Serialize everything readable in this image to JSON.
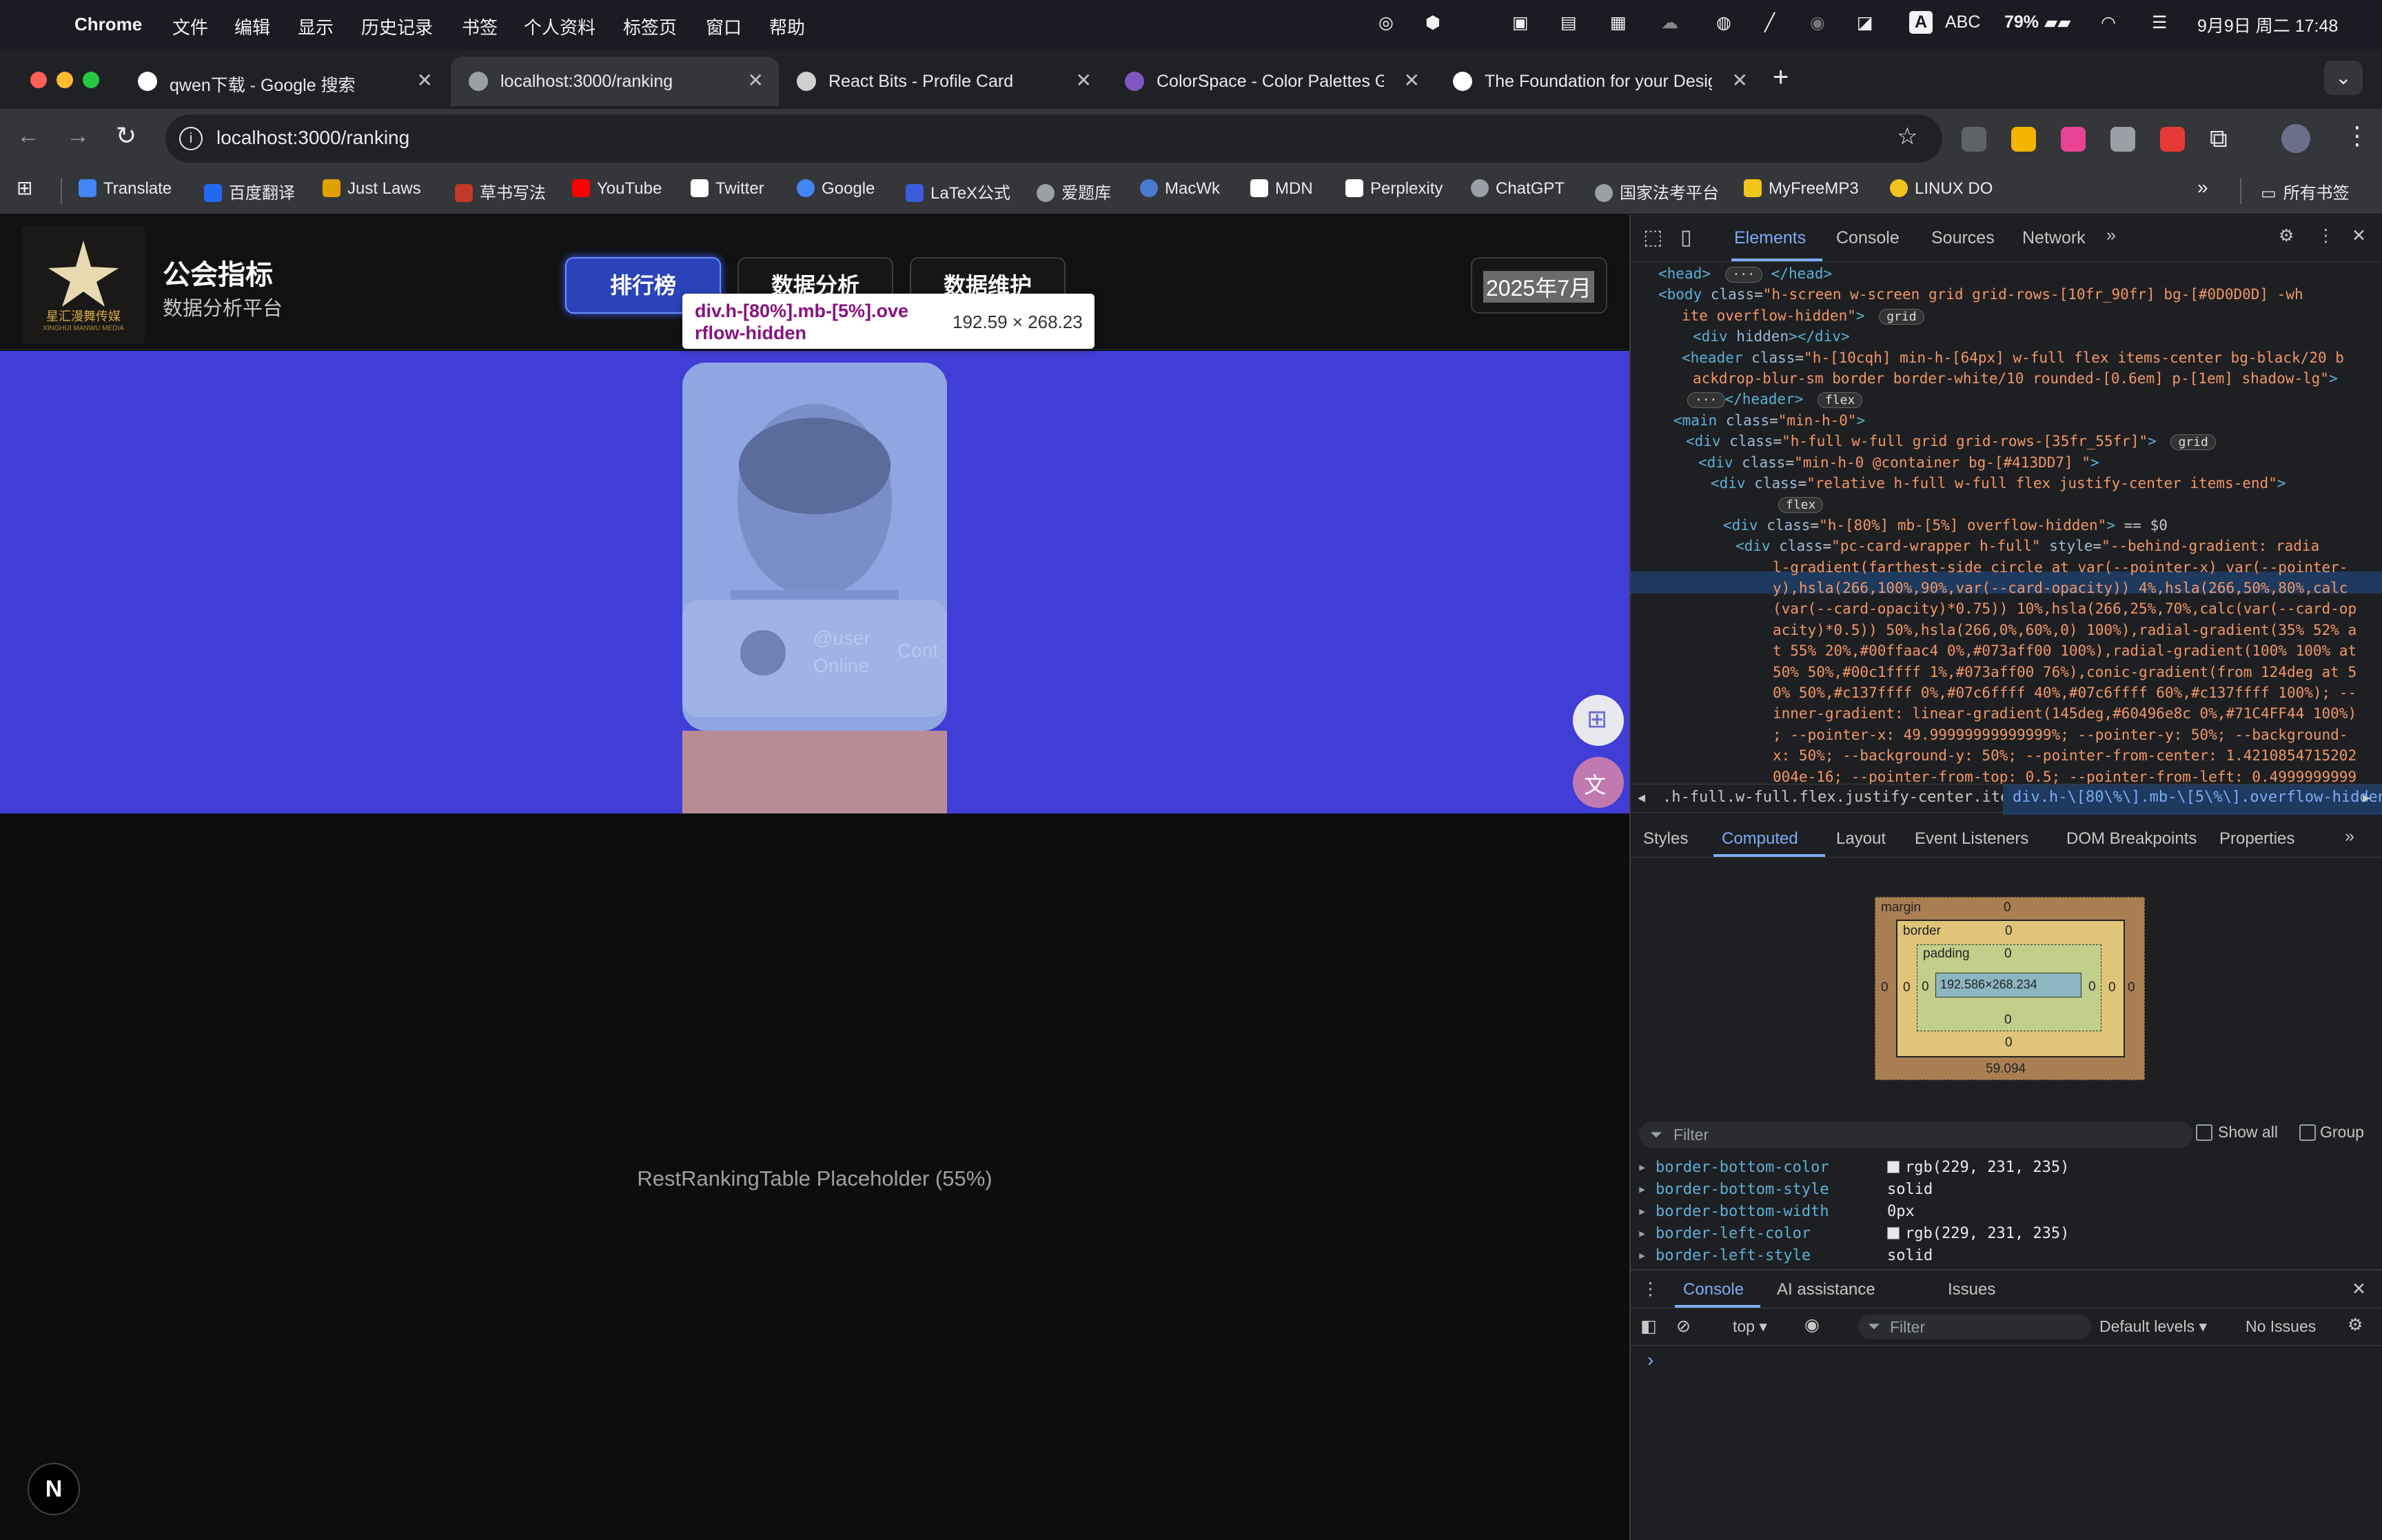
{
  "menubar": {
    "app": "Chrome",
    "items": [
      "文件",
      "编辑",
      "显示",
      "历史记录",
      "书签",
      "个人资料",
      "标签页",
      "窗口",
      "帮助"
    ],
    "input_method": "A",
    "abc": "ABC",
    "battery": "79%",
    "datetime": "9月9日 周二 17:48"
  },
  "tabs": [
    {
      "title": "qwen下载 - Google 搜索",
      "active": false
    },
    {
      "title": "localhost:3000/ranking",
      "active": true
    },
    {
      "title": "React Bits - Profile Card",
      "active": false
    },
    {
      "title": "ColorSpace - Color Palettes G",
      "active": false
    },
    {
      "title": "The Foundation for your Desig",
      "active": false
    }
  ],
  "address": {
    "url": "localhost:3000/ranking"
  },
  "bookmarks": [
    {
      "label": "Translate",
      "color": "#4285f4"
    },
    {
      "label": "百度翻译",
      "color": "#2468f2"
    },
    {
      "label": "Just Laws",
      "color": "#e0a000"
    },
    {
      "label": "草书写法",
      "color": "#c0392b"
    },
    {
      "label": "YouTube",
      "color": "#ff0000"
    },
    {
      "label": "Twitter",
      "color": "#ffffff"
    },
    {
      "label": "Google",
      "color": "#4285f4"
    },
    {
      "label": "LaTeX公式",
      "color": "#3b5bdb"
    },
    {
      "label": "爱题库",
      "color": "#9aa0a6"
    },
    {
      "label": "MacWk",
      "color": "#4a7bd0"
    },
    {
      "label": "MDN",
      "color": "#ffffff"
    },
    {
      "label": "Perplexity",
      "color": "#ffffff"
    },
    {
      "label": "ChatGPT",
      "color": "#9aa0a6"
    },
    {
      "label": "国家法考平台",
      "color": "#9aa0a6"
    },
    {
      "label": "MyFreeMP3",
      "color": "#f0c419"
    },
    {
      "label": "LINUX DO",
      "color": "#f0c419"
    }
  ],
  "all_bookmarks": "所有书签",
  "app": {
    "logo_text": "星汇漫舞传媒",
    "logo_subtext": "XINGHUI MANWU MEDIA",
    "title": "公会指标",
    "subtitle": "数据分析平台",
    "nav": [
      "排行榜",
      "数据分析",
      "数据维护"
    ],
    "active_nav": "排行榜",
    "date_select": "2025年7月",
    "placeholder_text": "RestRankingTable Placeholder (55%)",
    "profile_card": {
      "handle": "@user",
      "status": "Online",
      "contact": "Cont"
    },
    "next_badge": "N"
  },
  "inspect_tooltip": {
    "selector_line1": "div.h-[80%].mb-[5%].ove",
    "selector_line2": "rflow-hidden",
    "size": "192.59 × 268.23"
  },
  "devtools": {
    "tabs": [
      "Elements",
      "Console",
      "Sources",
      "Network"
    ],
    "active_tab": "Elements",
    "dom": [
      {
        "html": "<span class='tag'>&lt;head&gt;</span> <span class='badge'>···</span> <span class='tag'>&lt;/head&gt;</span>"
      },
      {
        "html": "<span class='tag'>&lt;body</span> <span class='attr'>class</span>=<span class='val'>\"h-screen w-screen grid grid-rows-[10fr_90fr] bg-[#0D0D0D] -wh</span>"
      },
      {
        "html": "<span class='val'>ite overflow-hidden\"</span><span class='tag'>&gt;</span> <span class='badge'>grid</span>"
      },
      {
        "html": "<span class='tag'>&lt;div</span> <span class='attr'>hidden</span><span class='tag'>&gt;&lt;/div&gt;</span>"
      },
      {
        "html": "<span class='tag'>&lt;header</span> <span class='attr'>class</span>=<span class='val'>\"h-[10cqh] min-h-[64px] w-full flex items-center bg-black/20 b</span>"
      },
      {
        "html": "<span class='val'>ackdrop-blur-sm border border-white/10 rounded-[0.6em] p-[1em] shadow-lg\"</span><span class='tag'>&gt;</span>"
      },
      {
        "html": "<span class='badge'>···</span><span class='tag'>&lt;/header&gt;</span> <span class='badge'>flex</span>"
      },
      {
        "html": "<span class='tag'>&lt;main</span> <span class='attr'>class</span>=<span class='val'>\"min-h-0\"</span><span class='tag'>&gt;</span>"
      },
      {
        "html": "<span class='tag'>&lt;div</span> <span class='attr'>class</span>=<span class='val'>\"h-full w-full grid grid-rows-[35fr_55fr]\"</span><span class='tag'>&gt;</span> <span class='badge'>grid</span>"
      },
      {
        "html": "<span class='tag'>&lt;div</span> <span class='attr'>class</span>=<span class='val'>\"min-h-0 @container bg-[#413DD7] \"</span><span class='tag'>&gt;</span>"
      },
      {
        "html": "<span class='tag'>&lt;div</span> <span class='attr'>class</span>=<span class='val'>\"relative h-full w-full flex justify-center items-end\"</span><span class='tag'>&gt;</span>"
      },
      {
        "html": "<span class='badge'>flex</span>"
      },
      {
        "html": "<span class='tag'>&lt;div</span> <span class='attr'>class</span>=<span class='val'>\"h-[80%] mb-[5%] overflow-hidden\"</span><span class='tag'>&gt;</span> == $0"
      },
      {
        "html": "<span class='tag'>&lt;div</span> <span class='attr'>class</span>=<span class='val'>\"pc-card-wrapper h-full\"</span> <span class='attr'>style</span>=<span class='val'>\"--behind-gradient: radia</span>"
      },
      {
        "html": "<span class='val'>l-gradient(farthest-side circle at var(--pointer-x) var(--pointer-</span>"
      },
      {
        "html": "<span class='val'>y),hsla(266,100%,90%,var(--card-opacity)) 4%,hsla(266,50%,80%,calc</span>"
      },
      {
        "html": "<span class='val'>(var(--card-opacity)*0.75)) 10%,hsla(266,25%,70%,calc(var(--card-op</span>"
      },
      {
        "html": "<span class='val'>acity)*0.5)) 50%,hsla(266,0%,60%,0) 100%),radial-gradient(35% 52% a</span>"
      },
      {
        "html": "<span class='val'>t 55% 20%,#00ffaac4 0%,#073aff00 100%),radial-gradient(100% 100% at</span>"
      },
      {
        "html": "<span class='val'>50% 50%,#00c1ffff 1%,#073aff00 76%),conic-gradient(from 124deg at 5</span>"
      },
      {
        "html": "<span class='val'>0% 50%,#c137ffff 0%,#07c6ffff 40%,#07c6ffff 60%,#c137ffff 100%); --</span>"
      },
      {
        "html": "<span class='val'>inner-gradient: linear-gradient(145deg,#60496e8c 0%,#71C4FF44 100%)</span>"
      },
      {
        "html": "<span class='val'>; --pointer-x: 49.99999999999999%; --pointer-y: 50%; --background-</span>"
      },
      {
        "html": "<span class='val'>x: 50%; --background-y: 50%; --pointer-from-center: 1.4210854715202</span>"
      },
      {
        "html": "<span class='val'>004e-16; --pointer-from-top: 0.5; --pointer-from-left: 0.4999999999</span>"
      }
    ],
    "breadcrumb": [
      ".h-full.w-full.flex.justify-center.items-end",
      "div.h-\\[80\\%\\].mb-\\[5\\%\\].overflow-hidden"
    ],
    "subtabs": [
      "Styles",
      "Computed",
      "Layout",
      "Event Listeners",
      "DOM Breakpoints",
      "Properties"
    ],
    "active_subtab": "Computed",
    "boxmodel": {
      "margin_label": "margin",
      "border_label": "border",
      "padding_label": "padding",
      "margin": "0",
      "border": "0",
      "padding": "0",
      "content": "192.586×268.234",
      "margin_bottom_value": "59.094"
    },
    "filter_placeholder": "Filter",
    "show_all": "Show all",
    "group": "Group",
    "properties": [
      {
        "name": "border-bottom-color",
        "value": "rgb(229, 231, 235)",
        "swatch": true
      },
      {
        "name": "border-bottom-style",
        "value": "solid",
        "swatch": false
      },
      {
        "name": "border-bottom-width",
        "value": "0px",
        "swatch": false
      },
      {
        "name": "border-left-color",
        "value": "rgb(229, 231, 235)",
        "swatch": true
      },
      {
        "name": "border-left-style",
        "value": "solid",
        "swatch": false
      }
    ],
    "drawer_tabs": [
      "Console",
      "AI assistance",
      "Issues"
    ],
    "drawer_active": "Console",
    "console_context": "top",
    "console_filter": "Filter",
    "levels": "Default levels",
    "issues": "No Issues"
  },
  "colors": {
    "accent_blue": "#413dd7",
    "page_bg": "#0d0d0d",
    "devtools_bg": "#1e1f22",
    "highlight": "#7da6e8"
  }
}
